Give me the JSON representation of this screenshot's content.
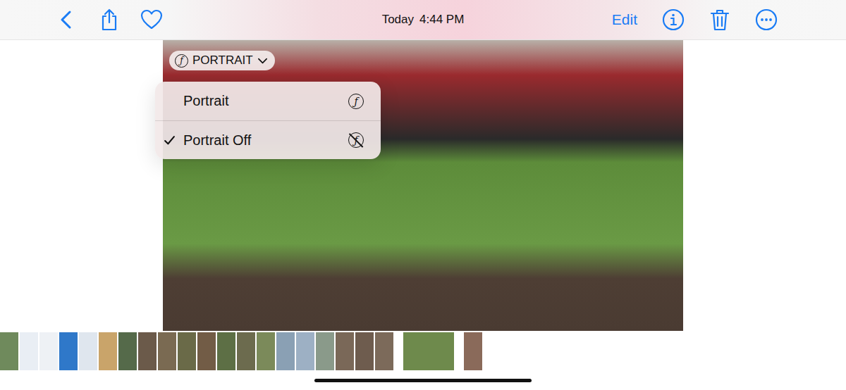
{
  "topbar": {
    "date": "Today",
    "time": "4:44 PM",
    "edit": "Edit"
  },
  "portrait_badge": {
    "glyph": "ƒ",
    "label": "PORTRAIT"
  },
  "portrait_menu": {
    "items": [
      {
        "label": "Portrait",
        "selected": false,
        "kind": "on"
      },
      {
        "label": "Portrait Off",
        "selected": true,
        "kind": "off"
      }
    ]
  },
  "thumbnails": [
    {
      "selected": false,
      "color": "#6f8a5c"
    },
    {
      "selected": false,
      "color": "#e9eef4"
    },
    {
      "selected": false,
      "color": "#eef1f5"
    },
    {
      "selected": false,
      "color": "#2f78c9"
    },
    {
      "selected": false,
      "color": "#dfe6ee"
    },
    {
      "selected": false,
      "color": "#c9a46a"
    },
    {
      "selected": false,
      "color": "#556a4a"
    },
    {
      "selected": false,
      "color": "#6b5a4a"
    },
    {
      "selected": false,
      "color": "#7a6a52"
    },
    {
      "selected": false,
      "color": "#6a6a48"
    },
    {
      "selected": false,
      "color": "#725c46"
    },
    {
      "selected": false,
      "color": "#5d6f45"
    },
    {
      "selected": false,
      "color": "#6c6b4e"
    },
    {
      "selected": false,
      "color": "#7b8a5a"
    },
    {
      "selected": false,
      "color": "#8aa0b4"
    },
    {
      "selected": false,
      "color": "#9db0c4"
    },
    {
      "selected": false,
      "color": "#8a9a8a"
    },
    {
      "selected": false,
      "color": "#7a6858"
    },
    {
      "selected": false,
      "color": "#6e5c4e"
    },
    {
      "selected": false,
      "color": "#7c6a5a"
    },
    {
      "selected": true,
      "color": "#6e8a4c"
    },
    {
      "selected": false,
      "color": "#8a6a5a"
    }
  ]
}
